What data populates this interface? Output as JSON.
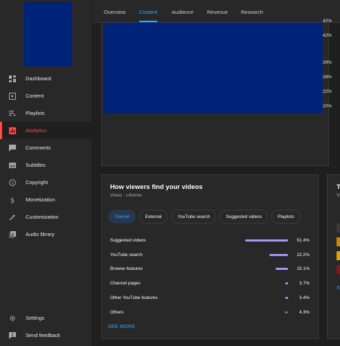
{
  "sidebar": {
    "items": [
      {
        "label": "Dashboard",
        "icon": "dashboard-icon"
      },
      {
        "label": "Content",
        "icon": "content-icon"
      },
      {
        "label": "Playlists",
        "icon": "playlists-icon"
      },
      {
        "label": "Analytics",
        "icon": "analytics-icon",
        "active": true
      },
      {
        "label": "Comments",
        "icon": "comments-icon"
      },
      {
        "label": "Subtitles",
        "icon": "subtitles-icon"
      },
      {
        "label": "Copyright",
        "icon": "copyright-icon"
      },
      {
        "label": "Monetization",
        "icon": "monetization-icon"
      },
      {
        "label": "Customization",
        "icon": "customization-icon"
      },
      {
        "label": "Audio library",
        "icon": "audio-library-icon"
      }
    ],
    "bottom": [
      {
        "label": "Settings",
        "icon": "gear-icon"
      },
      {
        "label": "Send feedback",
        "icon": "feedback-icon"
      }
    ]
  },
  "tabs": [
    "Overview",
    "Content",
    "Audience",
    "Revenue",
    "Research"
  ],
  "active_tab": "Content",
  "top_card": {
    "percentages": [
      "42%",
      "42%",
      "29%",
      "28%",
      "22%",
      "22%"
    ]
  },
  "traffic": {
    "title": "How viewers find your videos",
    "subtitle": "Views · Lifetime",
    "chips": [
      "Overall",
      "External",
      "YouTube search",
      "Suggested videos",
      "Playlists"
    ],
    "active_chip": "Overall",
    "rows": [
      {
        "name": "Suggested videos",
        "pct": "51.4%",
        "value": 51.4
      },
      {
        "name": "YouTube search",
        "pct": "22.2%",
        "value": 22.2
      },
      {
        "name": "Browse features",
        "pct": "15.1%",
        "value": 15.1
      },
      {
        "name": "Channel pages",
        "pct": "3.7%",
        "value": 3.7
      },
      {
        "name": "Other YouTube features",
        "pct": "3.4%",
        "value": 3.4
      },
      {
        "name": "Others",
        "pct": "4.3%",
        "value": 4.3
      }
    ],
    "see_more": "SEE MORE"
  },
  "right_card": {
    "title_partial": "To",
    "subtitle_partial": "Vi",
    "link_partial": "SE"
  },
  "colors": {
    "accent": "#3ea6ff",
    "active_nav": "#ff4e45",
    "bar": "#a29bfe",
    "thumb_blue": "#00237a"
  }
}
